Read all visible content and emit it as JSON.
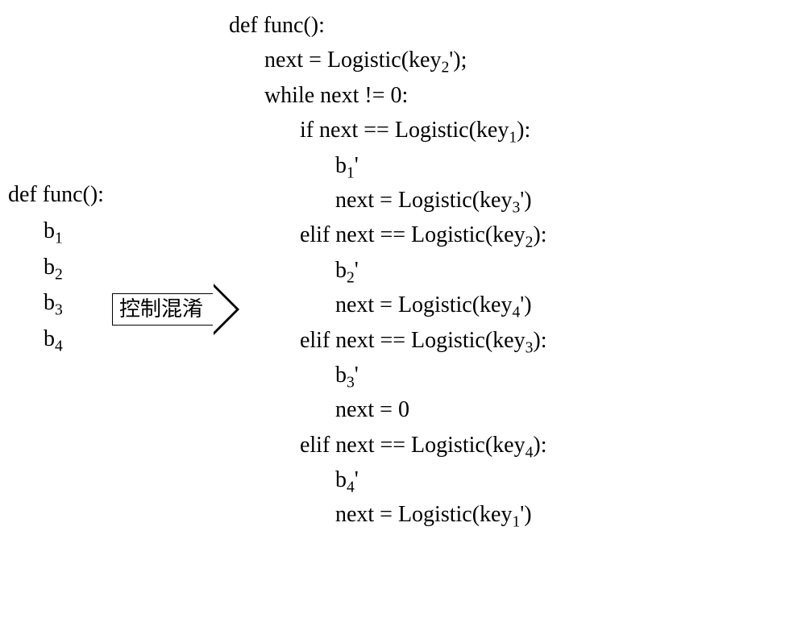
{
  "left": {
    "defLine": "def func():",
    "b1": "b",
    "b1_sub": "1",
    "b2": "b",
    "b2_sub": "2",
    "b3": "b",
    "b3_sub": "3",
    "b4": "b",
    "b4_sub": "4"
  },
  "arrow": {
    "label": "控制混淆"
  },
  "right": {
    "defLine": "def func():",
    "nextInit_a": "next = Logistic(key",
    "nextInit_sub": "2",
    "nextInit_b": "');",
    "whileLine": "while next != 0:",
    "if1_a": "if next == Logistic(key",
    "if1_sub": "1",
    "if1_b": "):",
    "b1_a": "b",
    "b1_sub": "1",
    "b1_b": "'",
    "n1_a": "next = Logistic(key",
    "n1_sub": "3",
    "n1_b": "')",
    "elif2_a": "elif next == Logistic(key",
    "elif2_sub": "2",
    "elif2_b": "):",
    "b2_a": "b",
    "b2_sub": "2",
    "b2_b": "'",
    "n2_a": "next = Logistic(key",
    "n2_sub": "4",
    "n2_b": "')",
    "elif3_a": "elif next == Logistic(key",
    "elif3_sub": "3",
    "elif3_b": "):",
    "b3_a": "b",
    "b3_sub": "3",
    "b3_b": "'",
    "n3": "next = 0",
    "elif4_a": "elif next == Logistic(key",
    "elif4_sub": "4",
    "elif4_b": "):",
    "b4_a": "b",
    "b4_sub": "4",
    "b4_b": "'",
    "n4_a": "next = Logistic(key",
    "n4_sub": "1",
    "n4_b": "')"
  }
}
